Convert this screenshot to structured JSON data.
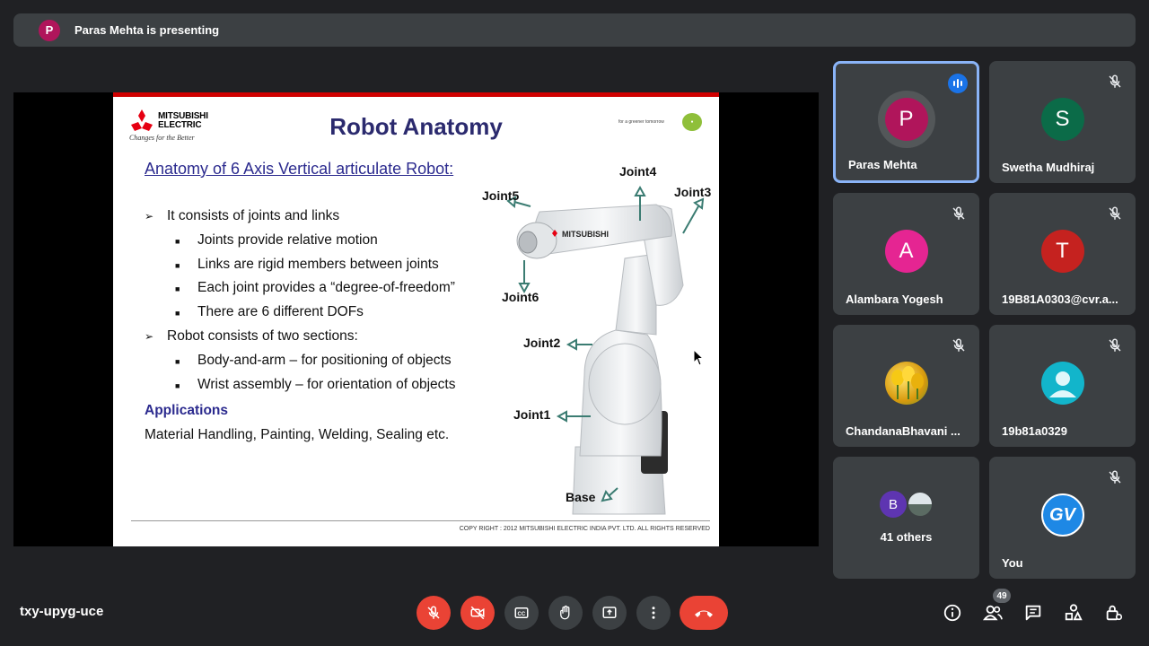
{
  "presenter": {
    "initial": "P",
    "text": "Paras Mehta is presenting"
  },
  "slide": {
    "logo_word1": "MITSUBISHI",
    "logo_word2": "ELECTRIC",
    "logo_tagline": "Changes for the Better",
    "title": "Robot Anatomy",
    "eco_text": "for a greener tomorrow",
    "subtitle": "Anatomy of 6 Axis Vertical articulate Robot:",
    "bullets": [
      "It consists of joints and links",
      "Joints provide relative motion",
      "Links are rigid members between joints",
      "Each joint provides a “degree-of-freedom”",
      "There are 6 different DOFs",
      "Robot consists of two sections:",
      "Body-and-arm – for positioning of objects",
      "Wrist assembly – for orientation of objects"
    ],
    "applications_heading": "Applications",
    "applications_text": "Material Handling, Painting, Welding, Sealing etc.",
    "joints": [
      "Joint4",
      "Joint5",
      "Joint3",
      "Joint6",
      "Joint2",
      "Joint1",
      "Base"
    ],
    "robot_brand": "MITSUBISHI",
    "copyright": "COPY RIGHT : 2012 MITSUBISHI ELECTRIC INDIA PVT. LTD. ALL RIGHTS RESERVED"
  },
  "participants": [
    {
      "name": "Paras Mehta",
      "initial": "P",
      "color": "#b0155b",
      "state": "speaking"
    },
    {
      "name": "Swetha Mudhiraj",
      "initial": "S",
      "color": "#0b6b48",
      "state": "muted"
    },
    {
      "name": "Alambara Yogesh",
      "initial": "A",
      "color": "#e52592",
      "state": "muted"
    },
    {
      "name": "19B81A0303@cvr.a...",
      "initial": "T",
      "color": "#c5221f",
      "state": "muted"
    },
    {
      "name": "ChandanaBhavani ...",
      "initial": "",
      "color": "#e5b814",
      "state": "muted"
    },
    {
      "name": "19b81a0329",
      "initial": "",
      "color": "#12b5cb",
      "state": "muted"
    },
    {
      "name": "41 others",
      "initial": "B",
      "color": "#5e35b1",
      "state": "group"
    },
    {
      "name": "You",
      "initial": "GV",
      "color": "#1e88e5",
      "state": "muted"
    }
  ],
  "meeting_code": "txy-upyg-uce",
  "participant_count": "49",
  "colors": {
    "accent": "#8ab4f8",
    "danger": "#ea4335",
    "surface": "#3c4043"
  },
  "icons": [
    "mic-off-icon",
    "camera-off-icon",
    "captions-icon",
    "raise-hand-icon",
    "present-icon",
    "more-icon",
    "end-call-icon",
    "info-icon",
    "people-icon",
    "chat-icon",
    "activities-icon",
    "host-controls-icon"
  ]
}
